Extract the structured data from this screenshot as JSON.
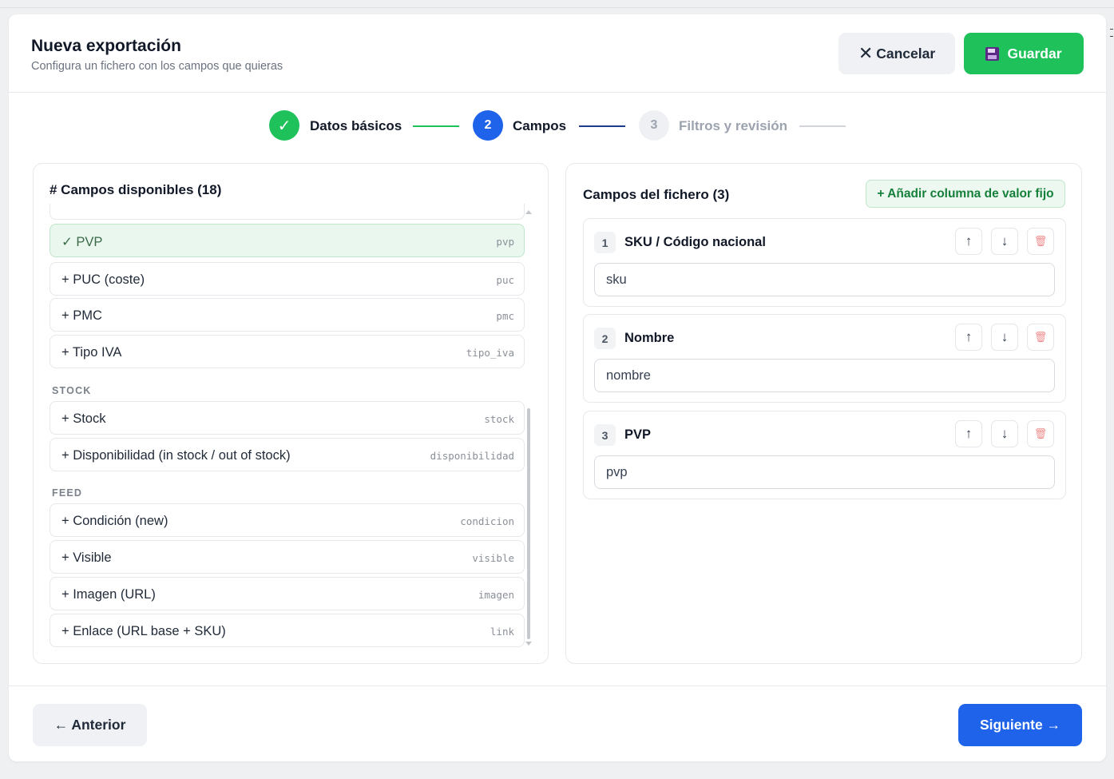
{
  "header": {
    "title": "Nueva exportación",
    "subtitle": "Configura un fichero con los campos que quieras",
    "cancel_label": "Cancelar",
    "save_label": "Guardar"
  },
  "stepper": {
    "steps": [
      {
        "number": "✓",
        "label": "Datos básicos",
        "state": "done"
      },
      {
        "number": "2",
        "label": "Campos",
        "state": "active"
      },
      {
        "number": "3",
        "label": "Filtros y revisión",
        "state": "pending"
      }
    ]
  },
  "available": {
    "title": "# Campos disponibles (18)",
    "items": [
      {
        "label": "✓ PVP",
        "key": "pvp",
        "selected": true
      },
      {
        "label": "+ PUC (coste)",
        "key": "puc",
        "selected": false
      },
      {
        "label": "+ PMC",
        "key": "pmc",
        "selected": false
      },
      {
        "label": "+ Tipo IVA",
        "key": "tipo_iva",
        "selected": false
      }
    ],
    "groups": [
      {
        "name": "STOCK",
        "items": [
          {
            "label": "+ Stock",
            "key": "stock"
          },
          {
            "label": "+ Disponibilidad (in stock / out of stock)",
            "key": "disponibilidad"
          }
        ]
      },
      {
        "name": "FEED",
        "items": [
          {
            "label": "+ Condición (new)",
            "key": "condicion"
          },
          {
            "label": "+ Visible",
            "key": "visible"
          },
          {
            "label": "+ Imagen (URL)",
            "key": "imagen"
          },
          {
            "label": "+ Enlace (URL base + SKU)",
            "key": "link"
          }
        ]
      }
    ]
  },
  "file_fields": {
    "title": "Campos del fichero (3)",
    "add_fixed_label": "+ Añadir columna de valor fijo",
    "items": [
      {
        "num": "1",
        "name": "SKU / Código nacional",
        "value": "sku"
      },
      {
        "num": "2",
        "name": "Nombre",
        "value": "nombre"
      },
      {
        "num": "3",
        "name": "PVP",
        "value": "pvp"
      }
    ],
    "up_symbol": "↑",
    "down_symbol": "↓"
  },
  "footer": {
    "prev_label": "← Anterior",
    "next_label": "Siguiente →"
  },
  "colors": {
    "green": "#1ec15a",
    "blue": "#1e63e9",
    "pending": "#9ca3af"
  }
}
